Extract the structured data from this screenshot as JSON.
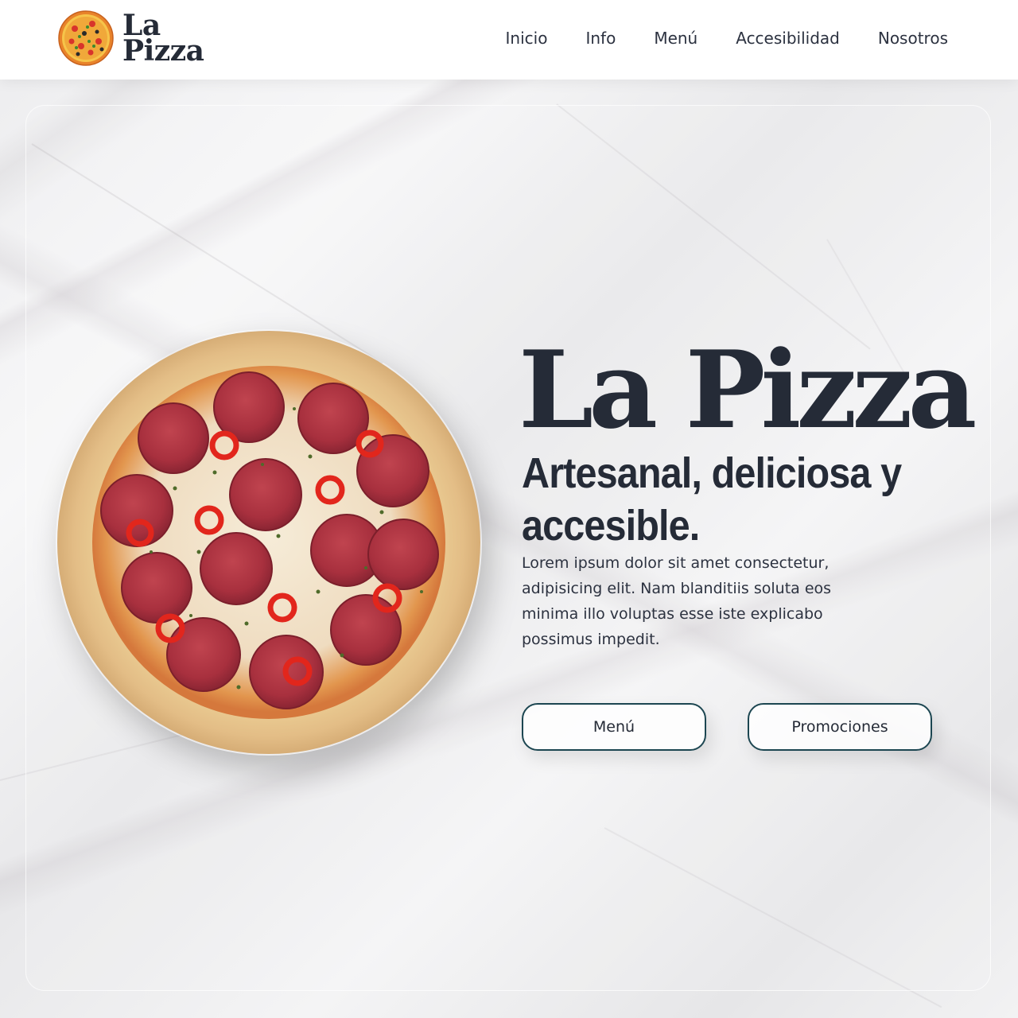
{
  "brand": {
    "line1": "La",
    "line2": "Pizza",
    "logo_icon": "pizza-logo-icon"
  },
  "nav": {
    "items": [
      {
        "label": "Inicio"
      },
      {
        "label": "Info"
      },
      {
        "label": "Menú"
      },
      {
        "label": "Accesibilidad"
      },
      {
        "label": "Nosotros"
      }
    ]
  },
  "hero": {
    "title": "La Pizza",
    "subtitle": "Artesanal, deliciosa y accesible.",
    "description": "Lorem ipsum dolor sit amet consectetur, adipisicing elit. Nam blanditiis soluta eos minima illo voluptas esse iste explicabo possimus impedit.",
    "image": "pepperoni-pizza-image",
    "buttons": {
      "menu_label": "Menú",
      "promo_label": "Promociones"
    }
  },
  "colors": {
    "text": "#252b37",
    "button_border": "#1c4651",
    "header_bg": "#ffffff"
  }
}
